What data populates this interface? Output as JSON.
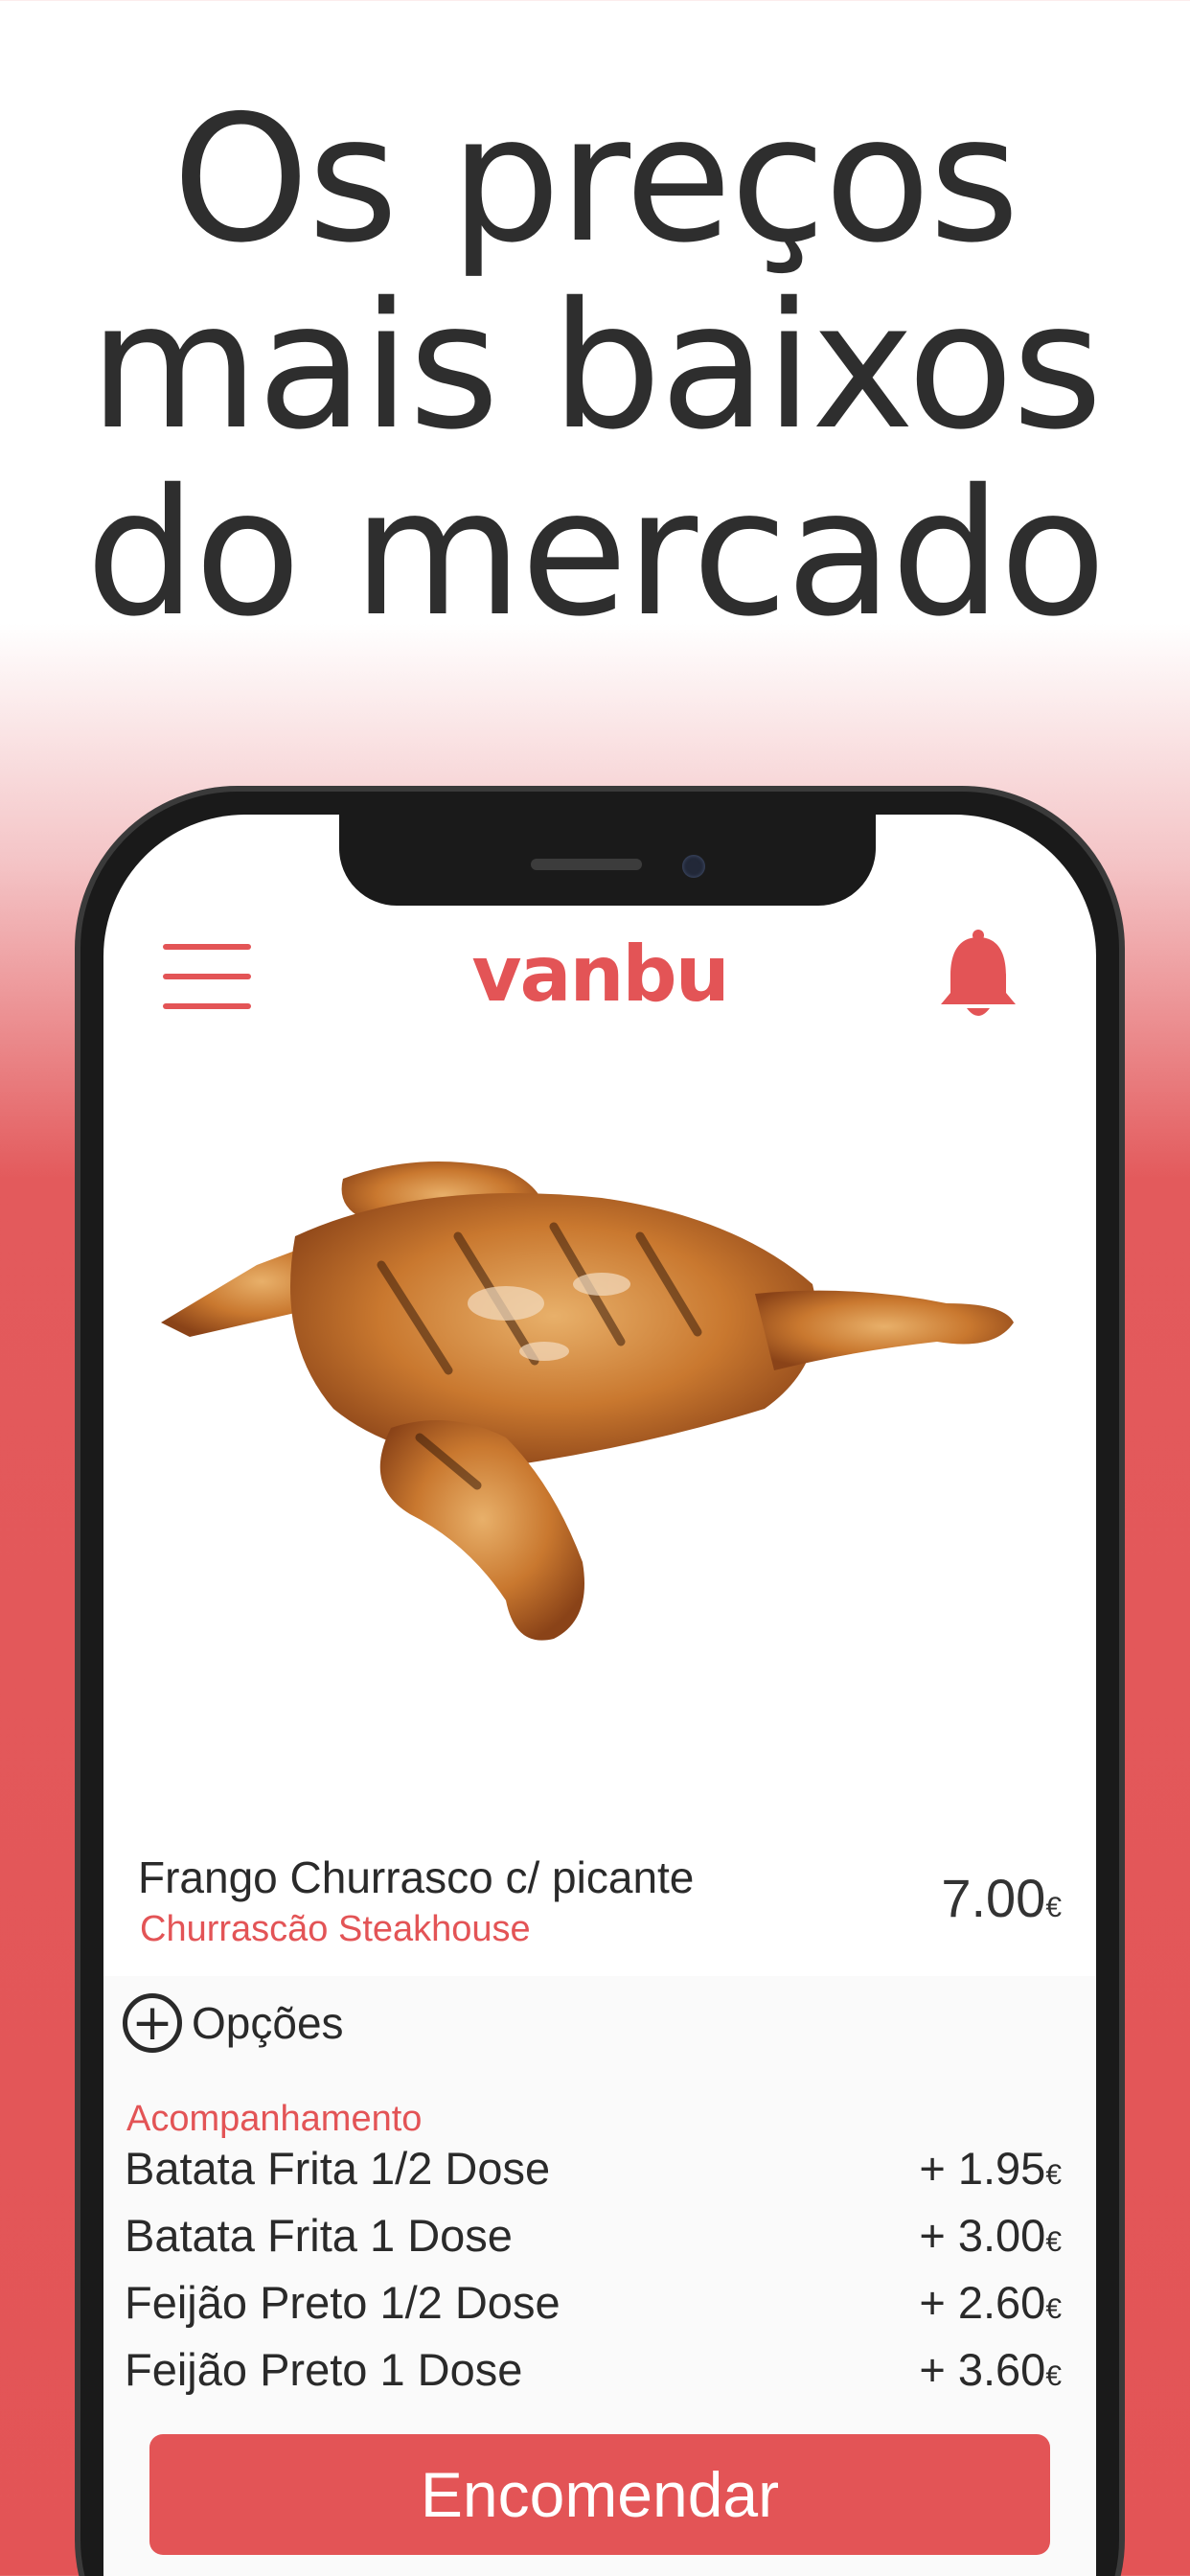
{
  "headline": {
    "line1": "Os preços",
    "line2": "mais baixos",
    "line3": "do mercado"
  },
  "app": {
    "logo_text": "vanbu",
    "brand_color": "#e35456"
  },
  "product": {
    "name": "Frango Churrasco c/ picante",
    "restaurant": "Churrascão Steakhouse",
    "price": "7.00",
    "currency": "€"
  },
  "options": {
    "toggle_label": "Opções",
    "group_title": "Acompanhamento",
    "items": [
      {
        "label": "Batata Frita 1/2 Dose",
        "price": "+ 1.95",
        "currency": "€"
      },
      {
        "label": "Batata Frita 1 Dose",
        "price": "+ 3.00",
        "currency": "€"
      },
      {
        "label": "Feijão Preto 1/2 Dose",
        "price": "+ 2.60",
        "currency": "€"
      },
      {
        "label": "Feijão Preto 1 Dose",
        "price": "+ 3.60",
        "currency": "€"
      }
    ]
  },
  "actions": {
    "order_label": "Encomendar"
  },
  "icons": [
    "menu-icon",
    "bell-icon",
    "plus-circle-icon"
  ]
}
